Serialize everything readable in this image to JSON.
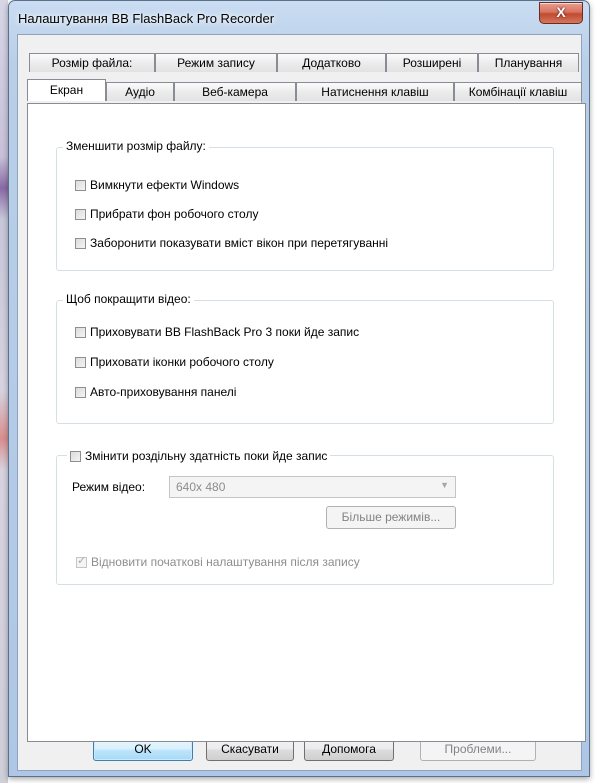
{
  "window": {
    "title": "Налаштування BB FlashBack Pro Recorder",
    "close_glyph": "X"
  },
  "tabs_row1": [
    {
      "label": "Розмір файла:"
    },
    {
      "label": "Режим запису"
    },
    {
      "label": "Додатково"
    },
    {
      "label": "Розширені"
    },
    {
      "label": "Планування"
    }
  ],
  "tabs_row2": [
    {
      "label": "Екран",
      "active": true
    },
    {
      "label": "Аудіо"
    },
    {
      "label": "Веб-камера"
    },
    {
      "label": "Натиснення клавіш"
    },
    {
      "label": "Комбінації клавіш"
    }
  ],
  "group_reduce": {
    "title": "Зменшити розмір файлу:",
    "options": [
      {
        "label": "Вимкнути ефекти Windows",
        "checked": false
      },
      {
        "label": "Прибрати фон робочого столу",
        "checked": false
      },
      {
        "label": "Заборонити показувати вміст вікон при перетягуванні",
        "checked": false
      }
    ]
  },
  "group_improve": {
    "title": "Щоб покращити відео:",
    "options": [
      {
        "label": "Приховувати BB FlashBack Pro 3 поки йде запис",
        "checked": false
      },
      {
        "label": "Приховати іконки робочого столу",
        "checked": false
      },
      {
        "label": "Авто-приховування панелі",
        "checked": false
      }
    ]
  },
  "group_resolution": {
    "toggle_label": "Змінити роздільну здатність поки йде запис",
    "toggle_checked": false,
    "video_mode_label": "Режим відео:",
    "video_mode_value": "640x 480",
    "more_modes_button": "Більше режимів...",
    "restore_label": "Відновити початкові налаштування після запису",
    "restore_checked": true
  },
  "buttons": {
    "ok": "OK",
    "cancel": "Скасувати",
    "help": "Допомога",
    "problems": "Проблеми..."
  }
}
